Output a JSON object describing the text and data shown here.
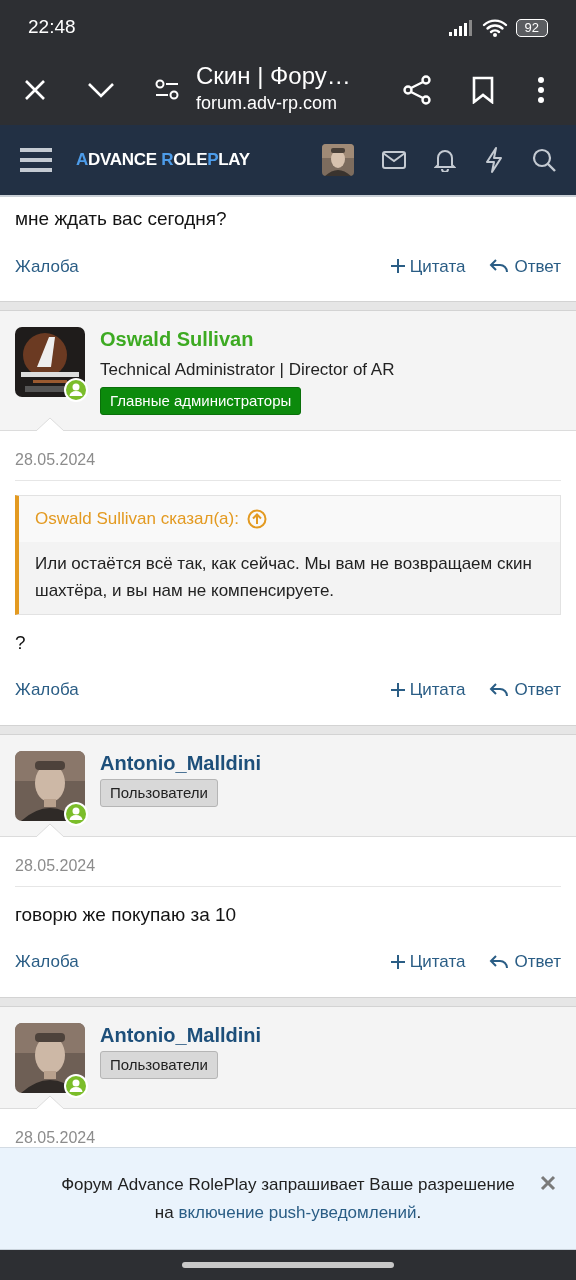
{
  "status_bar": {
    "time": "22:48",
    "battery": "92"
  },
  "browser": {
    "title": "Скин | Фору…",
    "url": "forum.adv-rp.com"
  },
  "site_nav": {
    "logo": [
      {
        "text": "A",
        "accent": true
      },
      {
        "text": "DVANCE ",
        "accent": false
      },
      {
        "text": "R",
        "accent": true
      },
      {
        "text": "OLE",
        "accent": false
      },
      {
        "text": "P",
        "accent": true
      },
      {
        "text": "LAY",
        "accent": false
      }
    ]
  },
  "posts": [
    {
      "kind": "partial",
      "body": [
        {
          "kind": "text",
          "text": "мне ждать вас сегодня?"
        }
      ],
      "actions": {
        "report": "Жалоба",
        "quote": "Цитата",
        "reply": "Ответ"
      }
    },
    {
      "kind": "full",
      "author": {
        "name": "Oswald Sullivan",
        "title": "Technical Administrator | Director of AR",
        "group": "Главные администраторы",
        "kind": "admin",
        "online": true
      },
      "date": "28.05.2024",
      "body": [
        {
          "kind": "quote",
          "author_line": "Oswald Sullivan сказал(а):",
          "text": "Или остаётся всё так, как сейчас. Мы вам не возвращаем скин шахтёра, и вы нам не компенсируете."
        },
        {
          "kind": "text",
          "text": "?"
        }
      ],
      "actions": {
        "report": "Жалоба",
        "quote": "Цитата",
        "reply": "Ответ"
      }
    },
    {
      "kind": "full",
      "author": {
        "name": "Antonio_Malldini",
        "group": "Пользователи",
        "kind": "user",
        "online": true
      },
      "date": "28.05.2024",
      "body": [
        {
          "kind": "text",
          "text": "говорю же покупаю за 10"
        }
      ],
      "actions": {
        "report": "Жалоба",
        "quote": "Цитата",
        "reply": "Ответ"
      }
    },
    {
      "kind": "full",
      "author": {
        "name": "Antonio_Malldini",
        "group": "Пользователи",
        "kind": "user",
        "online": true
      },
      "date": "28.05.2024"
    }
  ],
  "notice": {
    "text": "Форум Advance RolePlay запрашивает Ваше разрешение на ",
    "link": "включение push-уведомлений",
    "end": "."
  }
}
